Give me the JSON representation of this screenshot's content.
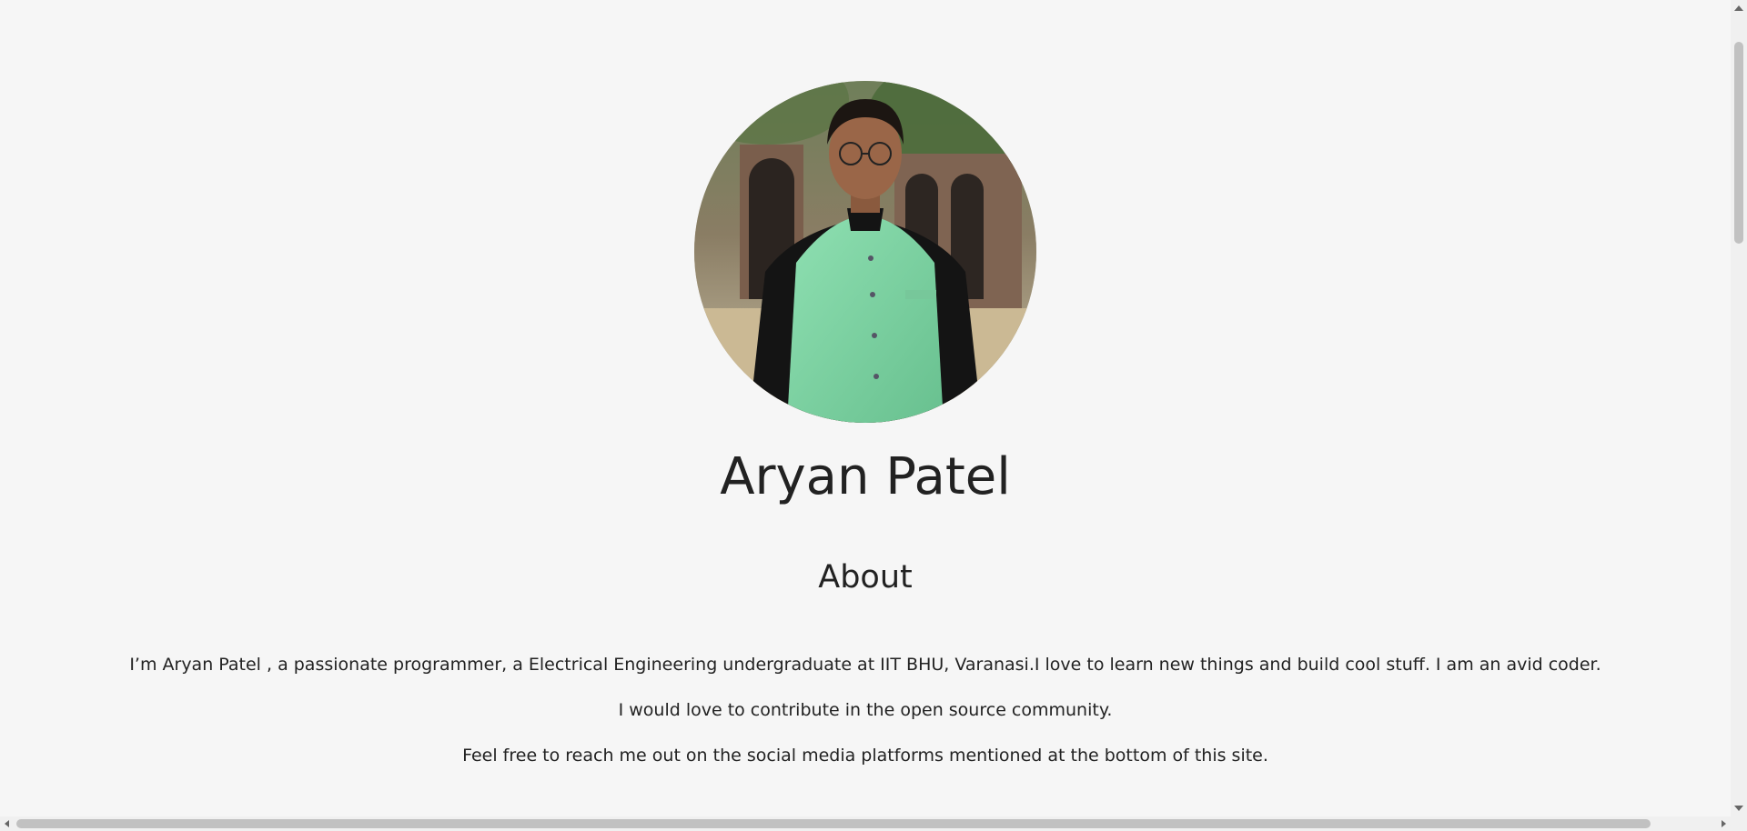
{
  "profile": {
    "photo_alt": "Aryan Patel",
    "name": "Aryan Patel"
  },
  "about": {
    "heading": "About",
    "paragraphs": [
      "I’m Aryan Patel , a passionate programmer, a Electrical Engineering undergraduate at IIT BHU, Varanasi.I love to learn new things and build cool stuff. I am an avid coder.",
      "I would love to contribute in the open source community.",
      "Feel free to reach me out on the social media platforms mentioned at the bottom of this site."
    ]
  },
  "colors": {
    "background": "#f6f6f6",
    "text": "#222222",
    "vest": "#7fd6a4"
  }
}
